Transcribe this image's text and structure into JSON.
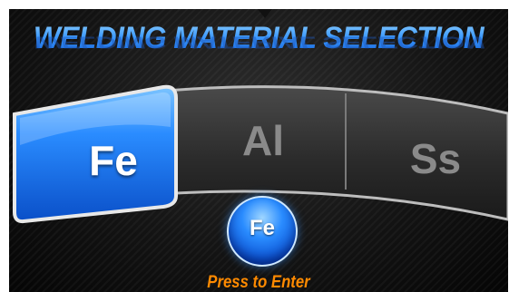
{
  "screen": {
    "title": "WELDING MATERIAL SELECTION",
    "title_reflection": "WELDING MATERIAL SELECTION"
  },
  "materials": {
    "selected": "Fe",
    "tabs": [
      {
        "label": "Fe",
        "state": "selected"
      },
      {
        "label": "Al",
        "state": "unselected"
      },
      {
        "label": "Ss",
        "state": "unselected"
      }
    ]
  },
  "enter_button": {
    "label": "Fe",
    "caption": "Press to Enter"
  },
  "colors": {
    "accent_blue": "#1a7cf0",
    "caption_orange": "#ff8a00",
    "unselected_text": "#8a8a8a",
    "background": "#141414"
  }
}
